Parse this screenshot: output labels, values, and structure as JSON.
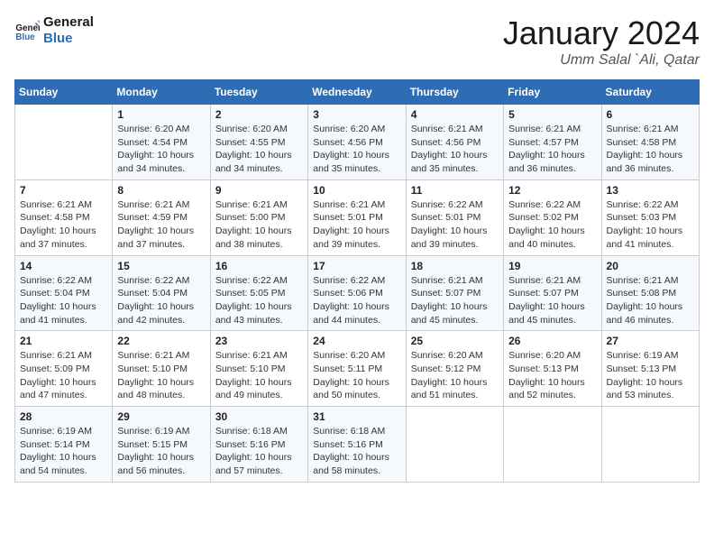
{
  "logo": {
    "line1": "General",
    "line2": "Blue"
  },
  "title": "January 2024",
  "location": "Umm Salal `Ali, Qatar",
  "days_header": [
    "Sunday",
    "Monday",
    "Tuesday",
    "Wednesday",
    "Thursday",
    "Friday",
    "Saturday"
  ],
  "weeks": [
    [
      {
        "day": "",
        "info": ""
      },
      {
        "day": "1",
        "info": "Sunrise: 6:20 AM\nSunset: 4:54 PM\nDaylight: 10 hours\nand 34 minutes."
      },
      {
        "day": "2",
        "info": "Sunrise: 6:20 AM\nSunset: 4:55 PM\nDaylight: 10 hours\nand 34 minutes."
      },
      {
        "day": "3",
        "info": "Sunrise: 6:20 AM\nSunset: 4:56 PM\nDaylight: 10 hours\nand 35 minutes."
      },
      {
        "day": "4",
        "info": "Sunrise: 6:21 AM\nSunset: 4:56 PM\nDaylight: 10 hours\nand 35 minutes."
      },
      {
        "day": "5",
        "info": "Sunrise: 6:21 AM\nSunset: 4:57 PM\nDaylight: 10 hours\nand 36 minutes."
      },
      {
        "day": "6",
        "info": "Sunrise: 6:21 AM\nSunset: 4:58 PM\nDaylight: 10 hours\nand 36 minutes."
      }
    ],
    [
      {
        "day": "7",
        "info": "Sunrise: 6:21 AM\nSunset: 4:58 PM\nDaylight: 10 hours\nand 37 minutes."
      },
      {
        "day": "8",
        "info": "Sunrise: 6:21 AM\nSunset: 4:59 PM\nDaylight: 10 hours\nand 37 minutes."
      },
      {
        "day": "9",
        "info": "Sunrise: 6:21 AM\nSunset: 5:00 PM\nDaylight: 10 hours\nand 38 minutes."
      },
      {
        "day": "10",
        "info": "Sunrise: 6:21 AM\nSunset: 5:01 PM\nDaylight: 10 hours\nand 39 minutes."
      },
      {
        "day": "11",
        "info": "Sunrise: 6:22 AM\nSunset: 5:01 PM\nDaylight: 10 hours\nand 39 minutes."
      },
      {
        "day": "12",
        "info": "Sunrise: 6:22 AM\nSunset: 5:02 PM\nDaylight: 10 hours\nand 40 minutes."
      },
      {
        "day": "13",
        "info": "Sunrise: 6:22 AM\nSunset: 5:03 PM\nDaylight: 10 hours\nand 41 minutes."
      }
    ],
    [
      {
        "day": "14",
        "info": "Sunrise: 6:22 AM\nSunset: 5:04 PM\nDaylight: 10 hours\nand 41 minutes."
      },
      {
        "day": "15",
        "info": "Sunrise: 6:22 AM\nSunset: 5:04 PM\nDaylight: 10 hours\nand 42 minutes."
      },
      {
        "day": "16",
        "info": "Sunrise: 6:22 AM\nSunset: 5:05 PM\nDaylight: 10 hours\nand 43 minutes."
      },
      {
        "day": "17",
        "info": "Sunrise: 6:22 AM\nSunset: 5:06 PM\nDaylight: 10 hours\nand 44 minutes."
      },
      {
        "day": "18",
        "info": "Sunrise: 6:21 AM\nSunset: 5:07 PM\nDaylight: 10 hours\nand 45 minutes."
      },
      {
        "day": "19",
        "info": "Sunrise: 6:21 AM\nSunset: 5:07 PM\nDaylight: 10 hours\nand 45 minutes."
      },
      {
        "day": "20",
        "info": "Sunrise: 6:21 AM\nSunset: 5:08 PM\nDaylight: 10 hours\nand 46 minutes."
      }
    ],
    [
      {
        "day": "21",
        "info": "Sunrise: 6:21 AM\nSunset: 5:09 PM\nDaylight: 10 hours\nand 47 minutes."
      },
      {
        "day": "22",
        "info": "Sunrise: 6:21 AM\nSunset: 5:10 PM\nDaylight: 10 hours\nand 48 minutes."
      },
      {
        "day": "23",
        "info": "Sunrise: 6:21 AM\nSunset: 5:10 PM\nDaylight: 10 hours\nand 49 minutes."
      },
      {
        "day": "24",
        "info": "Sunrise: 6:20 AM\nSunset: 5:11 PM\nDaylight: 10 hours\nand 50 minutes."
      },
      {
        "day": "25",
        "info": "Sunrise: 6:20 AM\nSunset: 5:12 PM\nDaylight: 10 hours\nand 51 minutes."
      },
      {
        "day": "26",
        "info": "Sunrise: 6:20 AM\nSunset: 5:13 PM\nDaylight: 10 hours\nand 52 minutes."
      },
      {
        "day": "27",
        "info": "Sunrise: 6:19 AM\nSunset: 5:13 PM\nDaylight: 10 hours\nand 53 minutes."
      }
    ],
    [
      {
        "day": "28",
        "info": "Sunrise: 6:19 AM\nSunset: 5:14 PM\nDaylight: 10 hours\nand 54 minutes."
      },
      {
        "day": "29",
        "info": "Sunrise: 6:19 AM\nSunset: 5:15 PM\nDaylight: 10 hours\nand 56 minutes."
      },
      {
        "day": "30",
        "info": "Sunrise: 6:18 AM\nSunset: 5:16 PM\nDaylight: 10 hours\nand 57 minutes."
      },
      {
        "day": "31",
        "info": "Sunrise: 6:18 AM\nSunset: 5:16 PM\nDaylight: 10 hours\nand 58 minutes."
      },
      {
        "day": "",
        "info": ""
      },
      {
        "day": "",
        "info": ""
      },
      {
        "day": "",
        "info": ""
      }
    ]
  ]
}
